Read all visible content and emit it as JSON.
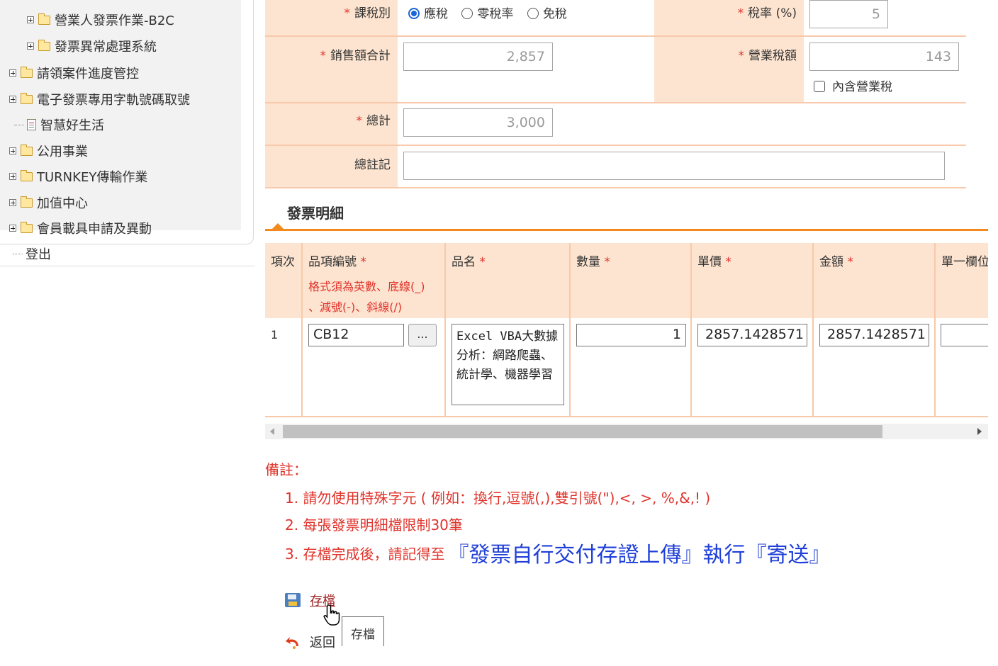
{
  "sidebar": {
    "items": [
      {
        "label": "營業人發票作業-B2C",
        "type": "folder"
      },
      {
        "label": "發票異常處理系統",
        "type": "folder"
      },
      {
        "label": "請領案件進度管控",
        "type": "folder"
      },
      {
        "label": "電子發票專用字軌號碼取號",
        "type": "folder"
      },
      {
        "label": "智慧好生活",
        "type": "doc"
      },
      {
        "label": "公用事業",
        "type": "folder"
      },
      {
        "label": "TURNKEY傳輸作業",
        "type": "folder"
      },
      {
        "label": "加值中心",
        "type": "folder"
      },
      {
        "label": "會員載具申請及異動",
        "type": "folder"
      }
    ],
    "logout": "登出"
  },
  "form": {
    "tax_type_label": "課稅別",
    "tax_options": [
      "應稅",
      "零稅率",
      "免稅"
    ],
    "tax_selected": "應稅",
    "tax_rate_label": "稅率 (%)",
    "tax_rate_value": "5",
    "sales_total_label": "銷售額合計",
    "sales_total_value": "2,857",
    "business_tax_label": "營業稅額",
    "business_tax_value": "143",
    "tax_included_label": "內含營業稅",
    "total_label": "總計",
    "total_value": "3,000",
    "remark_label": "總註記",
    "remark_value": ""
  },
  "details": {
    "section_title": "發票明細",
    "columns": {
      "index": "項次",
      "item_code": "品項編號",
      "item_code_hint_1": "格式須為英數、底線(_)",
      "item_code_hint_2": "、減號(-)、斜線(/)",
      "name": "品名",
      "qty": "數量",
      "unit_price": "單價",
      "amount": "金額",
      "unit_col": "單一欄位"
    },
    "required_mark": "*",
    "rows": [
      {
        "index": "1",
        "item_code": "CB12",
        "lookup_button": "...",
        "name": "Excel VBA大數據分析：網路爬蟲、統計學、機器學習",
        "qty": "1",
        "unit_price": "2857.1428571",
        "amount": "2857.1428571"
      }
    ]
  },
  "notes": {
    "title": "備註：",
    "items": [
      "1. 請勿使用特殊字元 ( 例如：換行,逗號(,),雙引號(\"),<, >, %,&,! )",
      "2. 每張發票明細檔限制30筆"
    ],
    "item3_prefix": "3. 存檔完成後，請記得至",
    "item3_highlight": "『發票自行交付存證上傳』執行『寄送』"
  },
  "actions": {
    "save_label": "存檔",
    "back_label": "返回",
    "tooltip": "存檔"
  },
  "colors": {
    "label_bg": "#fde4d0",
    "accent_orange": "#f28a1e",
    "required_red": "#e0322a",
    "highlight_blue": "#1f3fd8"
  }
}
